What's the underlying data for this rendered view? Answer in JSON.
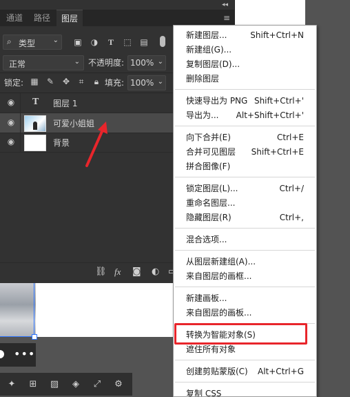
{
  "panel": {
    "tabs": [
      "通道",
      "路径",
      "图层"
    ],
    "active_tab": "图层",
    "filter": {
      "value": "类型"
    },
    "blend_mode": "正常",
    "opacity_label": "不透明度:",
    "opacity_value": "100%",
    "lock_label": "锁定:",
    "fill_label": "填充:",
    "fill_value": "100%",
    "layers": [
      {
        "name": "图层 1",
        "type": "text",
        "visible": true
      },
      {
        "name": "可爱小姐姐",
        "type": "image",
        "visible": true,
        "selected": true
      },
      {
        "name": "背景",
        "type": "background",
        "visible": true
      }
    ],
    "footer_fx": "fx"
  },
  "menu": {
    "groups": [
      [
        {
          "label": "新建图层...",
          "shortcut": "Shift+Ctrl+N"
        },
        {
          "label": "新建组(G)...",
          "shortcut": ""
        },
        {
          "label": "复制图层(D)...",
          "shortcut": ""
        },
        {
          "label": "删除图层",
          "shortcut": ""
        }
      ],
      [
        {
          "label": "快速导出为 PNG",
          "shortcut": "Shift+Ctrl+'"
        },
        {
          "label": "导出为...",
          "shortcut": "Alt+Shift+Ctrl+'"
        }
      ],
      [
        {
          "label": "向下合并(E)",
          "shortcut": "Ctrl+E"
        },
        {
          "label": "合并可见图层",
          "shortcut": "Shift+Ctrl+E"
        },
        {
          "label": "拼合图像(F)",
          "shortcut": ""
        }
      ],
      [
        {
          "label": "锁定图层(L)...",
          "shortcut": "Ctrl+/"
        },
        {
          "label": "重命名图层...",
          "shortcut": ""
        },
        {
          "label": "隐藏图层(R)",
          "shortcut": "Ctrl+,"
        }
      ],
      [
        {
          "label": "混合选项...",
          "shortcut": ""
        }
      ],
      [
        {
          "label": "从图层新建组(A)...",
          "shortcut": ""
        },
        {
          "label": "来自图层的画框...",
          "shortcut": ""
        }
      ],
      [
        {
          "label": "新建画板...",
          "shortcut": ""
        },
        {
          "label": "来自图层的画板...",
          "shortcut": ""
        }
      ],
      [
        {
          "label": "转换为智能对象(S)",
          "shortcut": ""
        },
        {
          "label": "遮住所有对象",
          "shortcut": ""
        }
      ],
      [
        {
          "label": "创建剪贴蒙版(C)",
          "shortcut": "Alt+Ctrl+G"
        }
      ],
      [
        {
          "label": "复制 CSS",
          "shortcut": ""
        }
      ]
    ],
    "highlighted_item": "转换为智能对象(S)"
  },
  "colors": {
    "highlight": "#e8252b",
    "arrow": "#e8252b",
    "selection_handle": "#2b73ff"
  }
}
